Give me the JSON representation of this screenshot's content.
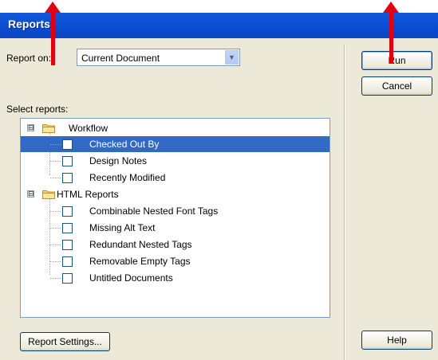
{
  "window": {
    "title": "Reports"
  },
  "report_on": {
    "label": "Report on:",
    "value": "Current Document"
  },
  "buttons": {
    "run": "Run",
    "cancel": "Cancel",
    "help": "Help",
    "report_settings": "Report Settings..."
  },
  "select_reports": {
    "label": "Select reports:",
    "groups": [
      {
        "label": "Workflow",
        "expander": "⊟",
        "items": [
          {
            "label": "Checked Out By",
            "selected": true
          },
          {
            "label": "Design Notes"
          },
          {
            "label": "Recently Modified"
          }
        ]
      },
      {
        "label": "HTML Reports",
        "expander": "⊟",
        "items": [
          {
            "label": "Combinable Nested Font Tags"
          },
          {
            "label": "Missing Alt Text"
          },
          {
            "label": "Redundant Nested Tags"
          },
          {
            "label": "Removable Empty Tags"
          },
          {
            "label": "Untitled Documents"
          }
        ]
      }
    ]
  },
  "colors": {
    "title_bar": "#0a4bcf",
    "selection": "#316ac5",
    "annotation_arrow": "#e00012",
    "dialog_bg": "#ece9d8"
  },
  "icons": {
    "folder": "folder-icon",
    "dropdown": "chevron-down-icon",
    "expand": "collapse-icon"
  }
}
